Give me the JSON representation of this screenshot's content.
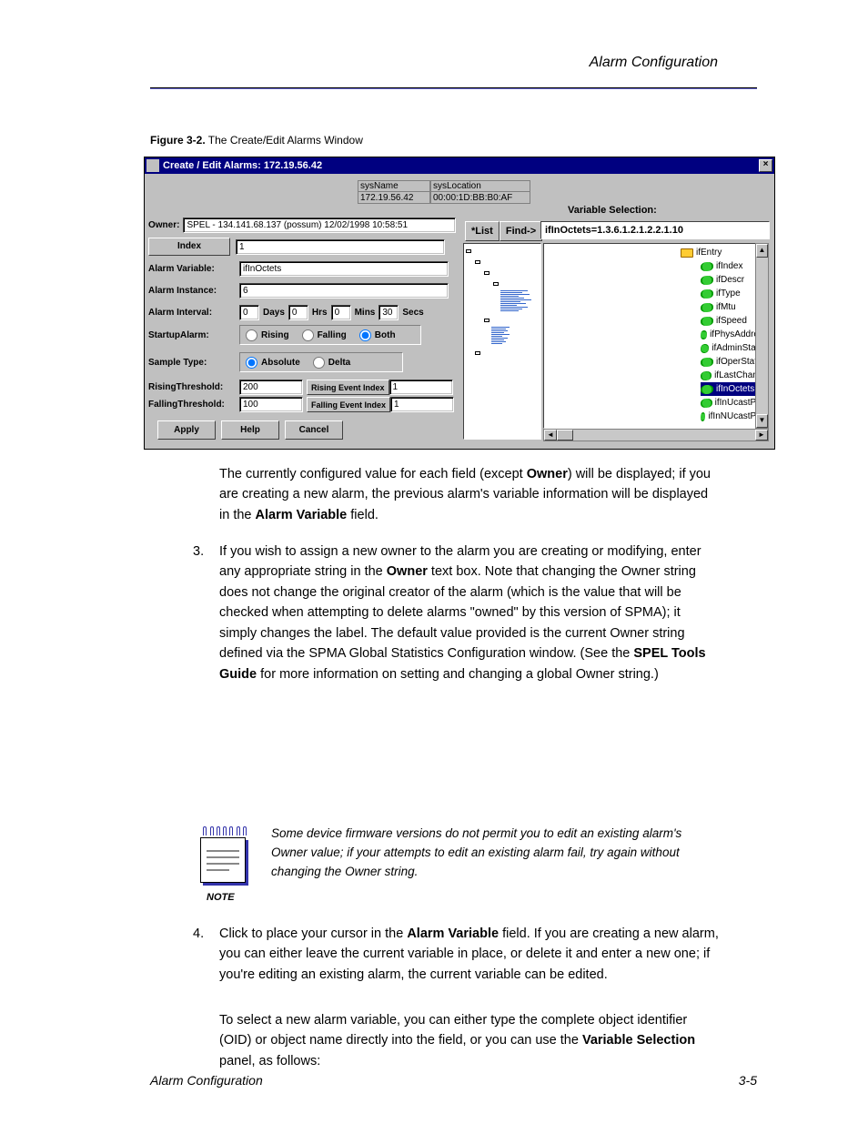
{
  "page": {
    "header": "Alarm Configuration",
    "figure_label_bold": "Figure 3-2.",
    "figure_label_rest": " The Create/Edit Alarms Window",
    "footer_title": "Alarm Configuration",
    "page_num": "3-5"
  },
  "win": {
    "title": "Create / Edit Alarms: 172.19.56.42",
    "close": "×",
    "sys": {
      "name_lbl": "sysName",
      "name_val": "172.19.56.42",
      "loc_lbl": "sysLocation",
      "loc_val": "00:00:1D:BB:B0:AF"
    },
    "owner_lbl": "Owner:",
    "owner_val": "SPEL - 134.141.68.137 (possum) 12/02/1998 10:58:51",
    "list_btn": "*List",
    "find_btn": "Find->",
    "varsel_lbl": "Variable Selection:",
    "varsel_val": "ifInOctets=1.3.6.1.2.1.2.2.1.10",
    "form": {
      "index_lbl": "Index",
      "index_val": "1",
      "var_lbl": "Alarm Variable:",
      "var_val": "ifInOctets",
      "inst_lbl": "Alarm Instance:",
      "inst_val": "6",
      "interval_lbl": "Alarm Interval:",
      "interval_days": "0",
      "days_u": "Days",
      "interval_hrs": "0",
      "hrs_u": "Hrs",
      "interval_mins": "0",
      "mins_u": "Mins",
      "interval_secs": "30",
      "secs_u": "Secs",
      "startup_lbl": "StartupAlarm:",
      "startup_rising": "Rising",
      "startup_falling": "Falling",
      "startup_both": "Both",
      "sample_lbl": "Sample Type:",
      "sample_abs": "Absolute",
      "sample_delta": "Delta",
      "rising_lbl": "RisingThreshold:",
      "rising_val": "200",
      "rising_ev_lbl": "Rising Event Index",
      "rising_ev_val": "1",
      "falling_lbl": "FallingThreshold:",
      "falling_val": "100",
      "falling_ev_lbl": "Falling Event Index",
      "falling_ev_val": "1"
    },
    "btns": {
      "apply": "Apply",
      "help": "Help",
      "cancel": "Cancel"
    },
    "tree": {
      "parent": "ifEntry",
      "items": [
        "ifIndex",
        "ifDescr",
        "ifType",
        "ifMtu",
        "ifSpeed",
        "ifPhysAddress",
        "ifAdminStatus",
        "ifOperStatus",
        "ifLastChange",
        "ifInOctets",
        "ifInUcastPkts",
        "ifInNUcastPkts"
      ],
      "selected": "ifInOctets"
    }
  },
  "body": {
    "p1a": "The currently configured value for each field (except ",
    "p1_owner": "Owner",
    "p1b": ") will be displayed; if you are creating a new alarm, the previous alarm's variable information will be displayed in the ",
    "p1_av": "Alarm Variable",
    "p1c": " field.",
    "step3": "3.",
    "p2a": "If you wish to assign a new owner to the alarm you are creating or modifying, enter any appropriate string in the ",
    "p2_owner": "Owner",
    "p2b": " text box. Note that changing the Owner string does not change the original creator of the alarm (which is the value that will be checked when attempting to delete alarms \"owned\" by this version of SPMA); it simply changes the label. The default value provided is the current Owner string defined via the SPMA Global Statistics Configuration window. (See the ",
    "p2_tools": "SPEL Tools Guide",
    "p2c": " for more information on setting and changing a global Owner string.)",
    "p3a": "Some device firmware versions do not permit you to edit an existing alarm's Owner value; if your attempts to edit an existing alarm fail, try again without changing the Owner string.",
    "note_lbl": "NOTE",
    "step4": "4.",
    "p4a": "Click to place your cursor in the ",
    "p4_av": "Alarm Variable",
    "p4b": " field. If you are creating a new alarm, you can either leave the current variable in place, or delete it and enter a new one; if you're editing an existing alarm, the current variable can be edited.",
    "p5a": "To select a new alarm variable, you can either type the complete object identifier (OID) or object name directly into the field, or you can use the ",
    "p5_vs": "Variable Selection",
    "p5b": " panel, as follows:"
  }
}
